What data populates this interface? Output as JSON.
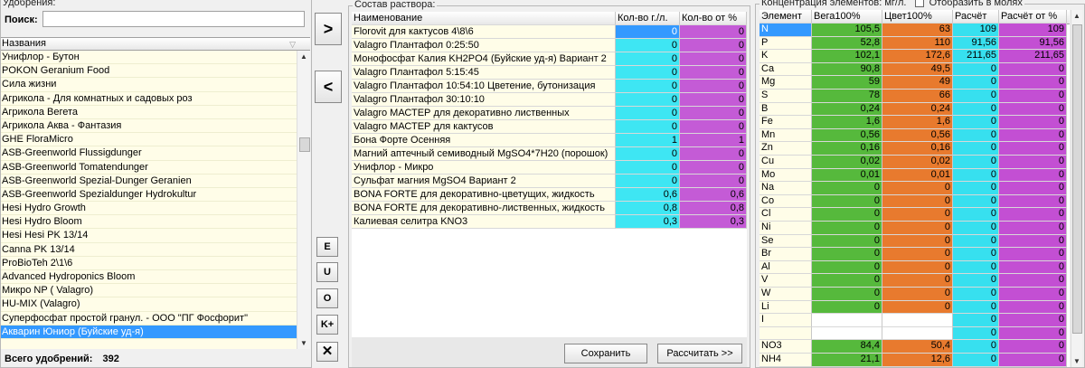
{
  "left": {
    "group_title": "Удобрения:",
    "search_label": "Поиск:",
    "search_value": "",
    "list_header": "Названия",
    "items": [
      "Унифлор - Бутон",
      "POKON Geranium Food",
      "Сила жизни",
      "Агрикола - Для комнатных и садовых роз",
      "Агрикола Вегета",
      "Агрикола Аква - Фантазия",
      "GHE FloraMicro",
      "ASB-Greenworld Flussigdunger",
      "ASB-Greenworld Tomatendunger",
      "ASB-Greenworld Spezial-Dunger Geranien",
      "ASB-Greenworld Spezialdunger Hydrokultur",
      "Hesi Hydro Growth",
      "Hesi Hydro Bloom",
      "Hesi Hesi PK 13/14",
      "Canna PK 13/14",
      "ProBioTeh 2\\1\\6",
      "Advanced Hydroponics Bloom",
      "Микро NP  ( Valagro)",
      "HU-MIX (Valagro)",
      "Суперфосфат простой гранул. - ООО \"ПГ Фосфорит\"",
      "Акварин Юниор (Буйские уд-я)"
    ],
    "selected_index": 20,
    "total_label": "Всего удобрений:",
    "total_value": "392"
  },
  "buttons": {
    "add": ">",
    "remove": "<",
    "e": "E",
    "u": "U",
    "o": "O",
    "k": "K+",
    "x": "✕"
  },
  "mid": {
    "group_title": "Состав раствора:",
    "headers": {
      "name": "Наименование",
      "g": "Кол-во г./л.",
      "pct": "Кол-во от %"
    },
    "rows": [
      {
        "name": "Florovit для кактусов 4\\8\\6",
        "g": "0",
        "pct": "0"
      },
      {
        "name": "Valagro Плантафол  0:25:50",
        "g": "0",
        "pct": "0"
      },
      {
        "name": "Монофосфат Калия KH2PO4 (Буйские уд-я) Вариант 2",
        "g": "0",
        "pct": "0"
      },
      {
        "name": "Valagro Плантафол 5:15:45",
        "g": "0",
        "pct": "0"
      },
      {
        "name": "Valagro Плантафол  10:54:10 Цветение, бутонизация",
        "g": "0",
        "pct": "0"
      },
      {
        "name": "Valagro Плантафол 30:10:10",
        "g": "0",
        "pct": "0"
      },
      {
        "name": "Valagro МАСТЕР для декоративно лиственных",
        "g": "0",
        "pct": "0"
      },
      {
        "name": "Valagro МАСТЕР для кактусов",
        "g": "0",
        "pct": "0"
      },
      {
        "name": "Бона Форте Осенняя",
        "g": "1",
        "pct": "1"
      },
      {
        "name": "Магний аптечный семиводный MgSO4*7H20 (порошок)",
        "g": "0",
        "pct": "0"
      },
      {
        "name": "Унифлор - Микро",
        "g": "0",
        "pct": "0"
      },
      {
        "name": "Сульфат магния MgSO4 Вариант 2",
        "g": "0",
        "pct": "0"
      },
      {
        "name": "BONA FORTE для декоративно-цветущих, жидкость",
        "g": "0,6",
        "pct": "0,6"
      },
      {
        "name": "BONA FORTE для декоративно-лиственных, жидкость",
        "g": "0,8",
        "pct": "0,8"
      },
      {
        "name": "Калиевая селитра KNO3",
        "g": "0,3",
        "pct": "0,3"
      }
    ],
    "save_label": "Сохранить",
    "calc_label": "Рассчитать >>"
  },
  "right": {
    "group_title": "Концентрация элементов: мг/л.",
    "view_toggle": "Отобразить в молях",
    "headers": {
      "el": "Элемент",
      "vega": "Вега100%",
      "cvet": "Цвет100%",
      "calc": "Расчёт",
      "calcpct": "Расчёт от %"
    },
    "rows": [
      {
        "el": "N",
        "vega": "105,5",
        "cvet": "63",
        "calc": "109",
        "calcpct": "109"
      },
      {
        "el": "P",
        "vega": "52,8",
        "cvet": "110",
        "calc": "91,56",
        "calcpct": "91,56"
      },
      {
        "el": "K",
        "vega": "102,1",
        "cvet": "172,6",
        "calc": "211,65",
        "calcpct": "211,65"
      },
      {
        "el": "Ca",
        "vega": "90,8",
        "cvet": "49,5",
        "calc": "0",
        "calcpct": "0"
      },
      {
        "el": "Mg",
        "vega": "59",
        "cvet": "49",
        "calc": "0",
        "calcpct": "0"
      },
      {
        "el": "S",
        "vega": "78",
        "cvet": "66",
        "calc": "0",
        "calcpct": "0"
      },
      {
        "el": "B",
        "vega": "0,24",
        "cvet": "0,24",
        "calc": "0",
        "calcpct": "0"
      },
      {
        "el": "Fe",
        "vega": "1,6",
        "cvet": "1,6",
        "calc": "0",
        "calcpct": "0"
      },
      {
        "el": "Mn",
        "vega": "0,56",
        "cvet": "0,56",
        "calc": "0",
        "calcpct": "0"
      },
      {
        "el": "Zn",
        "vega": "0,16",
        "cvet": "0,16",
        "calc": "0",
        "calcpct": "0"
      },
      {
        "el": "Cu",
        "vega": "0,02",
        "cvet": "0,02",
        "calc": "0",
        "calcpct": "0"
      },
      {
        "el": "Mo",
        "vega": "0,01",
        "cvet": "0,01",
        "calc": "0",
        "calcpct": "0"
      },
      {
        "el": "Na",
        "vega": "0",
        "cvet": "0",
        "calc": "0",
        "calcpct": "0"
      },
      {
        "el": "Co",
        "vega": "0",
        "cvet": "0",
        "calc": "0",
        "calcpct": "0"
      },
      {
        "el": "Cl",
        "vega": "0",
        "cvet": "0",
        "calc": "0",
        "calcpct": "0"
      },
      {
        "el": "Ni",
        "vega": "0",
        "cvet": "0",
        "calc": "0",
        "calcpct": "0"
      },
      {
        "el": "Se",
        "vega": "0",
        "cvet": "0",
        "calc": "0",
        "calcpct": "0"
      },
      {
        "el": "Br",
        "vega": "0",
        "cvet": "0",
        "calc": "0",
        "calcpct": "0"
      },
      {
        "el": "Al",
        "vega": "0",
        "cvet": "0",
        "calc": "0",
        "calcpct": "0"
      },
      {
        "el": "V",
        "vega": "0",
        "cvet": "0",
        "calc": "0",
        "calcpct": "0"
      },
      {
        "el": "W",
        "vega": "0",
        "cvet": "0",
        "calc": "0",
        "calcpct": "0"
      },
      {
        "el": "Li",
        "vega": "0",
        "cvet": "0",
        "calc": "0",
        "calcpct": "0"
      },
      {
        "el": "I",
        "vega": "",
        "cvet": "",
        "calc": "0",
        "calcpct": "0"
      },
      {
        "el": "",
        "vega": "",
        "cvet": "",
        "calc": "0",
        "calcpct": "0"
      },
      {
        "el": "NO3",
        "vega": "84,4",
        "cvet": "50,4",
        "calc": "0",
        "calcpct": "0"
      },
      {
        "el": "NH4",
        "vega": "21,1",
        "cvet": "12,6",
        "calc": "0",
        "calcpct": "0"
      }
    ]
  },
  "colors": {
    "cyan": "#3ee6f3",
    "magenta": "#c45bd6",
    "green": "#56b93c",
    "orange": "#e87a2e",
    "selection": "#3399ff",
    "list_bg": "#fffde8"
  }
}
